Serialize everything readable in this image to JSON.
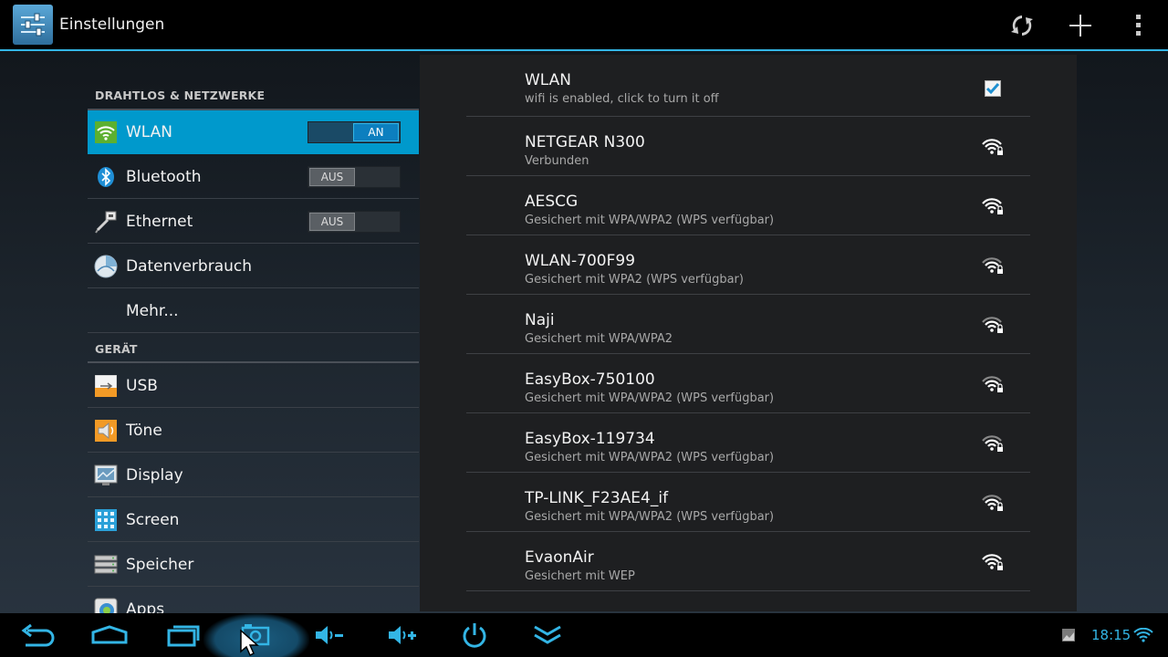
{
  "action_bar": {
    "title": "Einstellungen",
    "icons": [
      "settings-sliders-icon",
      "refresh-icon",
      "add-icon",
      "overflow-menu-icon"
    ]
  },
  "settings_list": {
    "sections": [
      {
        "header": "DRAHTLOS & NETZWERKE",
        "items": [
          {
            "label": "WLAN",
            "icon": "wifi-icon",
            "toggle": "AN",
            "active": true
          },
          {
            "label": "Bluetooth",
            "icon": "bluetooth-icon",
            "toggle": "AUS"
          },
          {
            "label": "Ethernet",
            "icon": "ethernet-icon",
            "toggle": "AUS"
          },
          {
            "label": "Datenverbrauch",
            "icon": "data-usage-icon"
          },
          {
            "label": "Mehr...",
            "icon": ""
          }
        ]
      },
      {
        "header": "GERÄT",
        "items": [
          {
            "label": "USB",
            "icon": "usb-icon"
          },
          {
            "label": "Töne",
            "icon": "speaker-icon"
          },
          {
            "label": "Display",
            "icon": "display-icon"
          },
          {
            "label": "Screen",
            "icon": "screen-grid-icon"
          },
          {
            "label": "Speicher",
            "icon": "storage-icon"
          },
          {
            "label": "Apps",
            "icon": "apps-icon"
          }
        ]
      }
    ]
  },
  "wifi_panel": {
    "wlan_toggle": {
      "name": "WLAN",
      "subtitle": "wifi is enabled, click to turn it off",
      "checked": true
    },
    "networks": [
      {
        "name": "NETGEAR N300",
        "subtitle": "Verbunden",
        "strength": "full"
      },
      {
        "name": "AESCG",
        "subtitle": "Gesichert mit WPA/WPA2 (WPS verfügbar)",
        "strength": "full"
      },
      {
        "name": "WLAN-700F99",
        "subtitle": "Gesichert mit WPA2 (WPS verfügbar)",
        "strength": "medium"
      },
      {
        "name": "Naji",
        "subtitle": "Gesichert mit WPA/WPA2",
        "strength": "medium"
      },
      {
        "name": "EasyBox-750100",
        "subtitle": "Gesichert mit WPA/WPA2 (WPS verfügbar)",
        "strength": "medium"
      },
      {
        "name": "EasyBox-119734",
        "subtitle": "Gesichert mit WPA/WPA2 (WPS verfügbar)",
        "strength": "medium"
      },
      {
        "name": "TP-LINK_F23AE4_if",
        "subtitle": "Gesichert mit WPA/WPA2 (WPS verfügbar)",
        "strength": "medium"
      },
      {
        "name": "EvaonAir",
        "subtitle": "Gesichert mit WEP",
        "strength": "full"
      }
    ]
  },
  "system_bar": {
    "nav_buttons": [
      "back-icon",
      "home-icon",
      "recent-apps-icon",
      "screenshot-icon",
      "volume-down-icon",
      "volume-up-icon",
      "power-icon",
      "hide-bar-icon"
    ],
    "clock": "18:15",
    "status_icons": [
      "gallery-notification-icon",
      "wifi-status-icon"
    ]
  },
  "colors": {
    "accent": "#33b5e5",
    "selected_row": "#0099cc",
    "wifi_green": "#6dc23f"
  }
}
